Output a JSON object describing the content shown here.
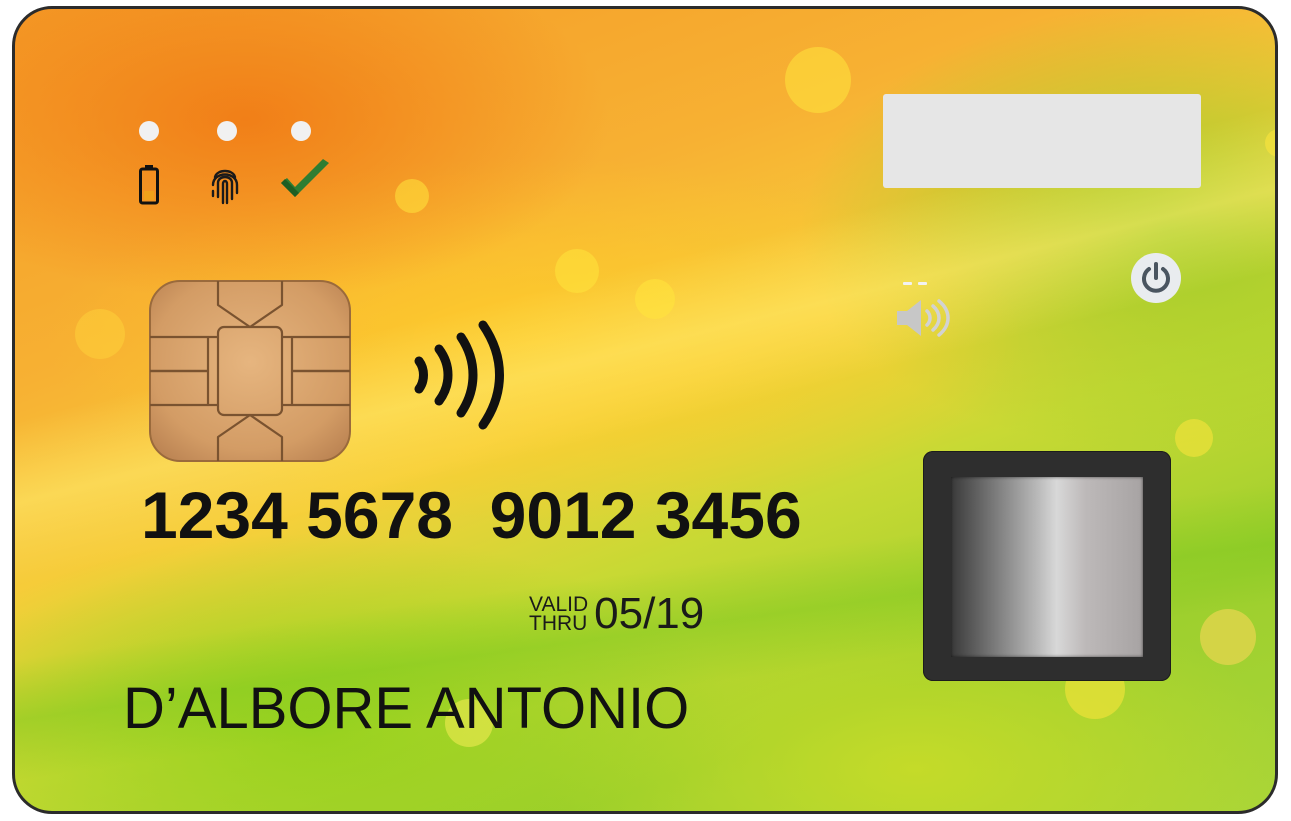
{
  "card": {
    "number": "1234 5678  9012 3456",
    "valid_label_top": "VALID",
    "valid_label_bottom": "THRU",
    "expiry": "05/19",
    "holder_name": "D’ALBORE ANTONIO"
  },
  "indicators": [
    {
      "icon": "battery-icon",
      "led_color": "#f1f1f1"
    },
    {
      "icon": "fingerprint-icon",
      "led_color": "#f1f1f1"
    },
    {
      "icon": "checkmark-icon",
      "led_color": "#f1f1f1"
    }
  ],
  "controls": {
    "power_icon": "power-icon",
    "speaker_icon": "speaker-icon"
  },
  "colors": {
    "card_orange": "#f49a26",
    "card_yellow": "#f6cf3a",
    "card_green": "#9dcf2d",
    "text": "#111111",
    "check_green": "#2e7d32",
    "sensor_frame": "#2e2e2e",
    "chip_gold": "#d9a66f"
  }
}
